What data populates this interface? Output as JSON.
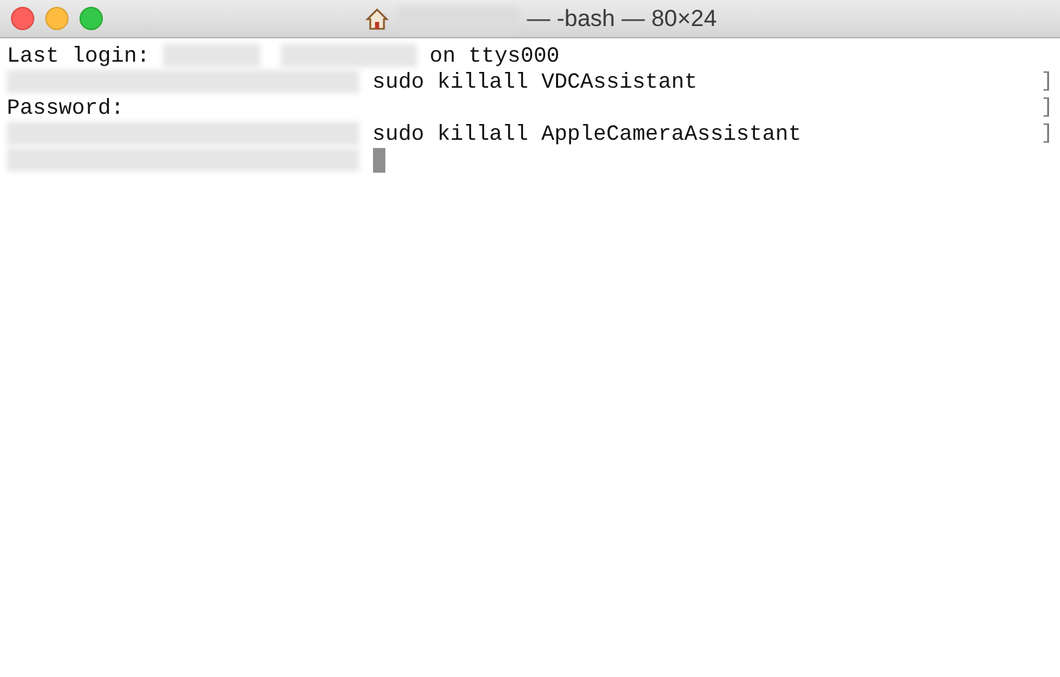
{
  "window": {
    "title": "— -bash — 80×24",
    "title_redacted": true
  },
  "lines": [
    {
      "segments": [
        {
          "kind": "text",
          "text": "Last login: "
        },
        {
          "kind": "redacted"
        },
        {
          "kind": "redacted"
        },
        {
          "kind": "text",
          "text": " on ttys000"
        }
      ]
    },
    {
      "segments": [
        {
          "kind": "redacted"
        },
        {
          "kind": "text",
          "text": " sudo killall VDCAssistant"
        }
      ],
      "end": "]"
    },
    {
      "segments": [
        {
          "kind": "text",
          "text": "Password:"
        }
      ],
      "end": "]"
    },
    {
      "segments": [
        {
          "kind": "redacted"
        },
        {
          "kind": "text",
          "text": " sudo killall AppleCameraAssistant"
        }
      ],
      "end": "]"
    },
    {
      "segments": [
        {
          "kind": "redacted"
        },
        {
          "kind": "cursor"
        }
      ]
    }
  ]
}
